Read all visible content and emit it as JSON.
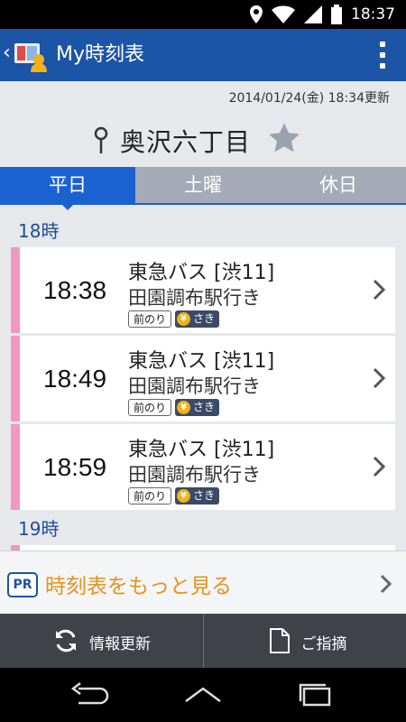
{
  "status_bar": {
    "time": "18:37",
    "icons": [
      "location-icon",
      "wifi-icon",
      "signal-icon",
      "battery-icon"
    ]
  },
  "app_bar": {
    "title": "My時刻表",
    "back_icon": "chevron-left-icon",
    "menu_icon": "overflow-menu-icon"
  },
  "header": {
    "updated": "2014/01/24(金) 18:34更新",
    "stop_name": "奥沢六丁目",
    "favorite_icon": "star-icon"
  },
  "tabs": [
    {
      "label": "平日",
      "active": true
    },
    {
      "label": "土曜",
      "active": false
    },
    {
      "label": "休日",
      "active": false
    }
  ],
  "timetable": {
    "hour_18": "18時",
    "hour_19": "19時",
    "rows": [
      {
        "time": "18:38",
        "company": "東急バス [渋11]",
        "destination": "田園調布駅行き",
        "tag_boarding": "前のり",
        "tag_fare": "さき"
      },
      {
        "time": "18:49",
        "company": "東急バス [渋11]",
        "destination": "田園調布駅行き",
        "tag_boarding": "前のり",
        "tag_fare": "さき"
      },
      {
        "time": "18:59",
        "company": "東急バス [渋11]",
        "destination": "田園調布駅行き",
        "tag_boarding": "前のり",
        "tag_fare": "さき"
      }
    ]
  },
  "promo": {
    "badge": "PR",
    "text": "時刻表をもっと見る"
  },
  "actions": {
    "refresh_label": "情報更新",
    "feedback_label": "ご指摘"
  },
  "colors": {
    "brand": "#1c54a6",
    "tab_active": "#1a62cf",
    "row_accent": "#f098c0",
    "promo_text": "#e8921a"
  }
}
